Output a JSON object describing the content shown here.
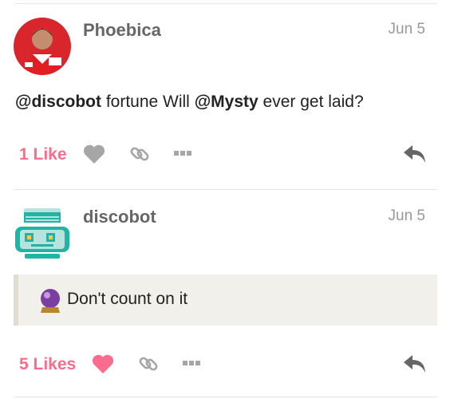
{
  "posts": [
    {
      "username": "Phoebica",
      "date": "Jun 5",
      "body": {
        "mention1": "@discobot",
        "text1": " fortune Will ",
        "mention2": "@Mysty",
        "text2": " ever get laid?"
      },
      "likes_label": "1 Like",
      "liked": false,
      "icons": [
        "heart-icon",
        "link-icon",
        "more-icon",
        "reply-icon"
      ]
    },
    {
      "username": "discobot",
      "date": "Jun 5",
      "quote": {
        "emoji_icon": "crystal-ball-icon",
        "text": "Don't count on it"
      },
      "likes_label": "5 Likes",
      "liked": true,
      "icons": [
        "heart-icon",
        "link-icon",
        "more-icon",
        "reply-icon"
      ]
    }
  ],
  "colors": {
    "like_pink": "#fa6c8d",
    "icon_gray": "#a6a6a6",
    "reply_gray": "#666666",
    "robot_teal": "#21b4a5"
  }
}
